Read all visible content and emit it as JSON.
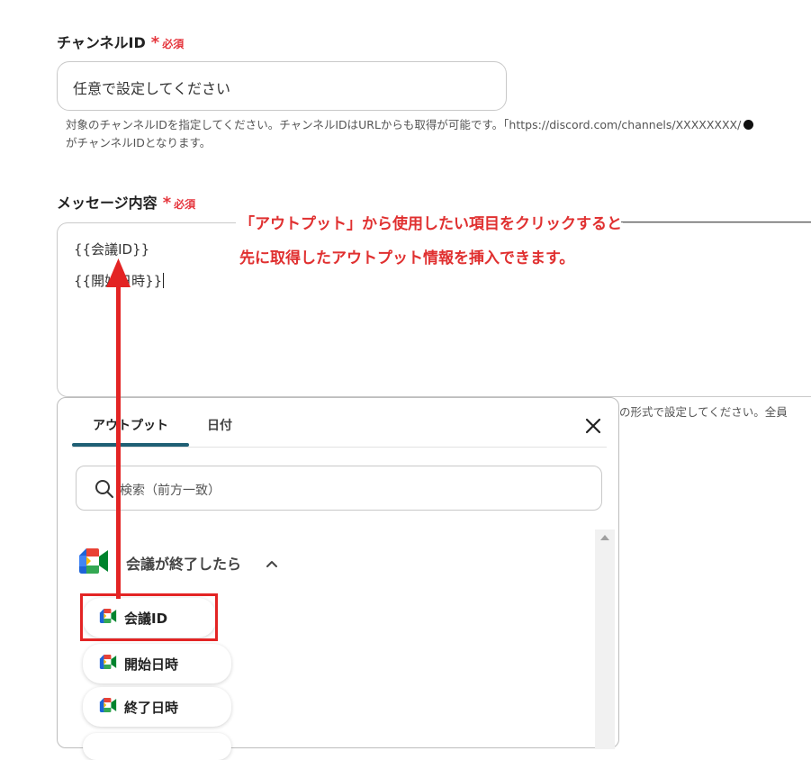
{
  "channel_id": {
    "label": "チャンネルID",
    "required_mark": "*",
    "required_text": "必須",
    "placeholder": "任意で設定してください",
    "help_line1": "対象のチャンネルIDを指定してください。チャンネルIDはURLからも取得が可能です。「https://discord.com/channels/XXXXXXXX/",
    "help_line2": "がチャンネルIDとなります。"
  },
  "message": {
    "label": "メッセージ内容",
    "required_mark": "*",
    "required_text": "必須",
    "line1": "{{会議ID}}",
    "line2": "{{開始日時}}",
    "help_tail": "の形式で設定してください。全員"
  },
  "annotation": {
    "line1": "「アウトプット」から使用したい項目をクリックすると",
    "line2": "先に取得したアウトプット情報を挿入できます。"
  },
  "output_panel": {
    "tabs": [
      {
        "label": "アウトプット",
        "active": true
      },
      {
        "label": "日付",
        "active": false
      }
    ],
    "search_placeholder": "検索（前方一致）",
    "group_title": "会議が終了したら",
    "items": [
      {
        "label": "会議ID",
        "highlighted": true
      },
      {
        "label": "開始日時",
        "highlighted": false
      },
      {
        "label": "終了日時",
        "highlighted": false
      }
    ]
  },
  "colors": {
    "accent_tab": "#1f5f74",
    "annotation_red": "#e03030",
    "required_red": "#e5363d"
  }
}
